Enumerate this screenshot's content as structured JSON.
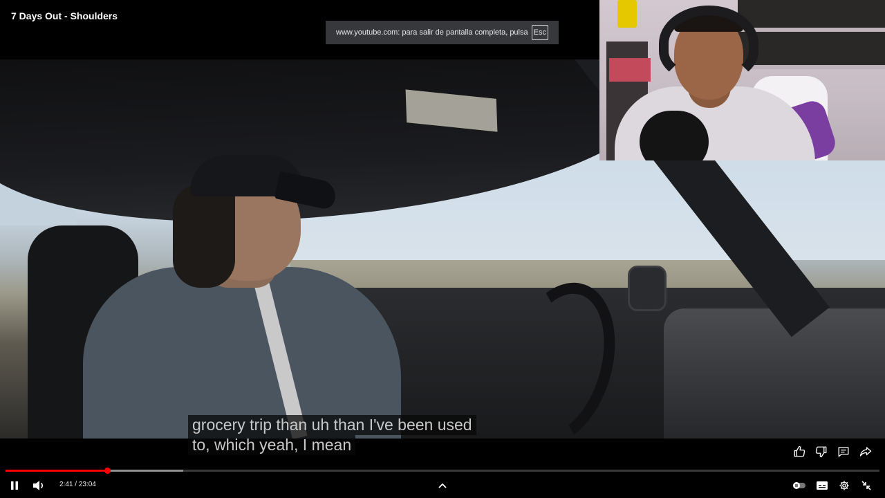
{
  "player": {
    "title": "7 Days Out - Shoulders",
    "fullscreen_notice": "www.youtube.com: para salir de pantalla completa, pulsa",
    "fullscreen_key": "Esc",
    "subtitles": [
      "grocery trip than uh than I've been used",
      "to, which yeah, I mean"
    ],
    "time_current": "2:41",
    "time_separator": "/",
    "time_total": "23:04",
    "played_fraction": 0.1163,
    "buffered_fraction": 0.203,
    "accent_color": "#ff0000",
    "icons": {
      "play_pause": "pause-icon",
      "volume": "volume-icon",
      "chevron": "chevron-up-icon",
      "autoplay": "autoplay-toggle-icon",
      "captions": "captions-icon",
      "settings": "gear-icon",
      "fullscreen": "exit-fullscreen-icon",
      "like": "thumbs-up-icon",
      "dislike": "thumbs-down-icon",
      "comments": "comment-icon",
      "share": "share-icon"
    }
  }
}
